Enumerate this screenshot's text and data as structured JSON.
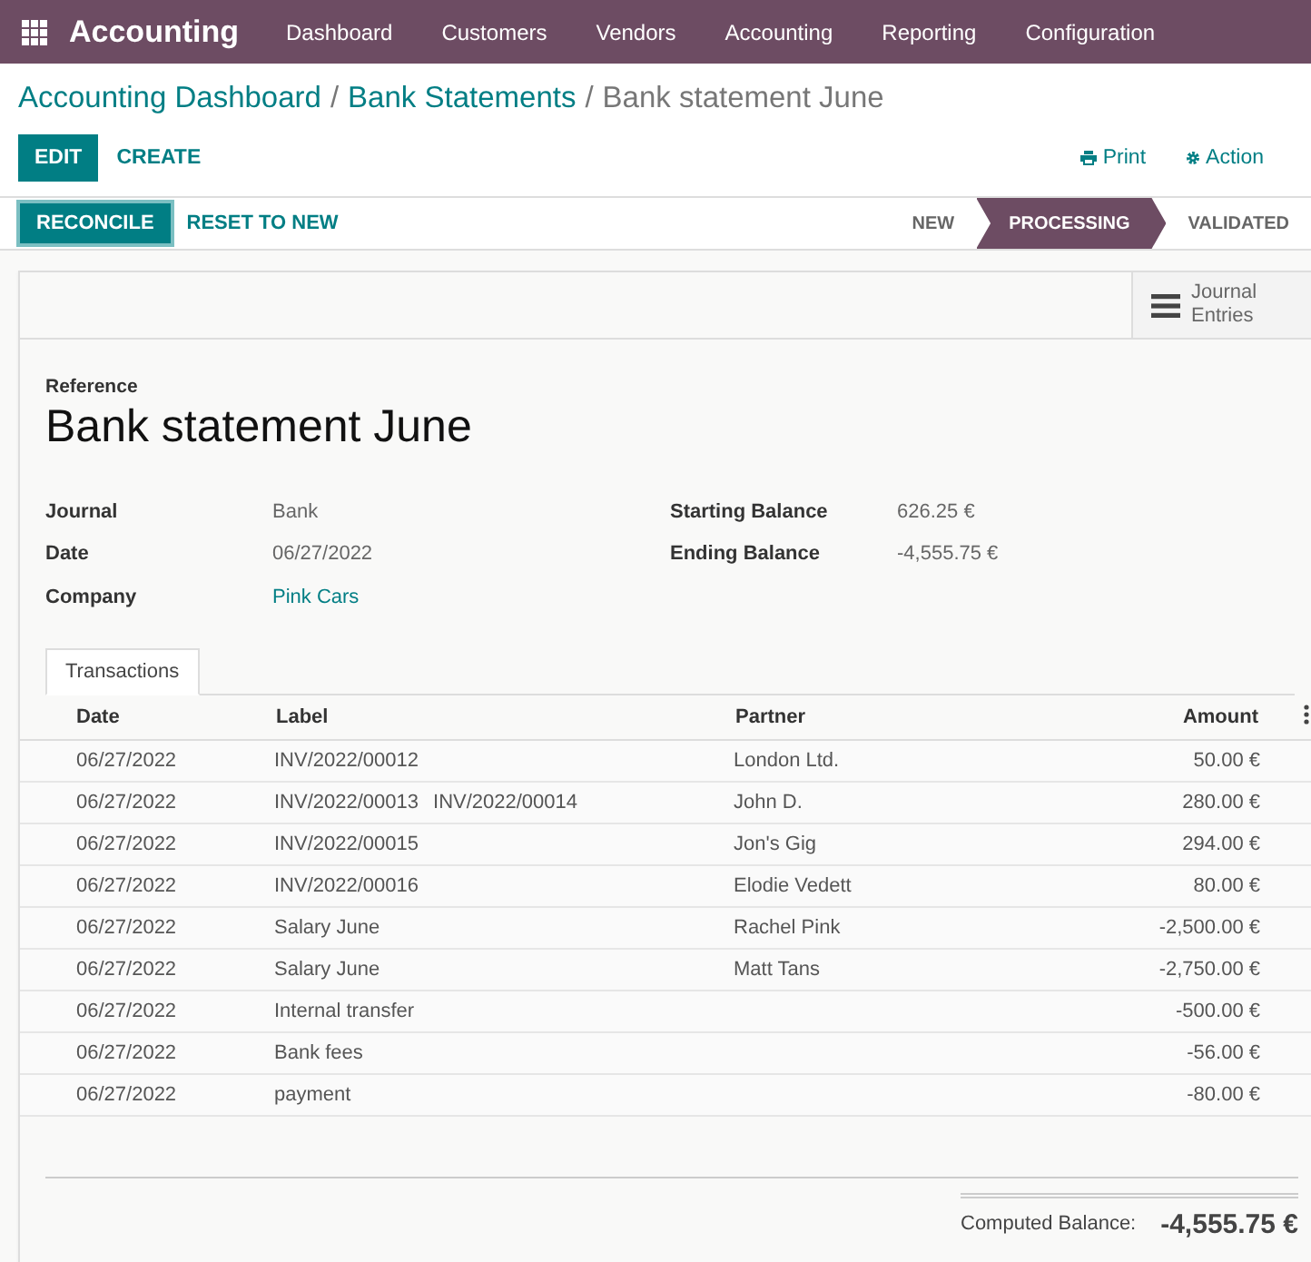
{
  "navbar": {
    "app_name": "Accounting",
    "menu": [
      "Dashboard",
      "Customers",
      "Vendors",
      "Accounting",
      "Reporting",
      "Configuration"
    ]
  },
  "breadcrumb": {
    "links": [
      {
        "label": "Accounting Dashboard",
        "separator": "/"
      },
      {
        "label": "Bank Statements",
        "separator": "/"
      }
    ],
    "current": "Bank statement June"
  },
  "control_buttons": [
    {
      "label": "EDIT",
      "kind": "primary"
    },
    {
      "label": "CREATE",
      "kind": "link"
    }
  ],
  "actions": [
    {
      "label": "Print",
      "kind": "print"
    },
    {
      "label": "Action",
      "kind": "gear"
    }
  ],
  "header_buttons": [
    {
      "label": "RECONCILE",
      "kind": "primary"
    },
    {
      "label": "RESET TO NEW",
      "kind": "link"
    }
  ],
  "status_steps": [
    {
      "label": "NEW",
      "selected": false
    },
    {
      "label": "PROCESSING",
      "selected": true
    },
    {
      "label": "VALIDATED",
      "selected": false
    }
  ],
  "smart_button": {
    "label": "Journal Entries"
  },
  "reference_label": "Reference",
  "title": "Bank statement June",
  "fields_left": [
    {
      "label": "Journal",
      "value": "Bank",
      "kind": "text"
    },
    {
      "label": "Date",
      "value": "06/27/2022",
      "kind": "text"
    },
    {
      "label": "Company",
      "value": "Pink Cars",
      "kind": "link"
    }
  ],
  "fields_right": [
    {
      "label": "Starting Balance",
      "value": "626.25 €"
    },
    {
      "label": "Ending Balance",
      "value": "-4,555.75 €"
    }
  ],
  "tabs": [
    {
      "label": "Transactions",
      "selected": true
    }
  ],
  "table": {
    "columns": [
      "Date",
      "Label",
      "Partner",
      "Amount"
    ],
    "rows": [
      {
        "date": "06/27/2022",
        "labels": [
          "INV/2022/00012"
        ],
        "partner": "London Ltd.",
        "amount": "50.00 €"
      },
      {
        "date": "06/27/2022",
        "labels": [
          "INV/2022/00013",
          "INV/2022/00014"
        ],
        "partner": "John D.",
        "amount": "280.00 €"
      },
      {
        "date": "06/27/2022",
        "labels": [
          "INV/2022/00015"
        ],
        "partner": "Jon's Gig",
        "amount": "294.00 €"
      },
      {
        "date": "06/27/2022",
        "labels": [
          "INV/2022/00016"
        ],
        "partner": "Elodie Vedett",
        "amount": "80.00 €"
      },
      {
        "date": "06/27/2022",
        "labels": [
          "Salary June"
        ],
        "partner": "Rachel Pink",
        "amount": "-2,500.00 €"
      },
      {
        "date": "06/27/2022",
        "labels": [
          "Salary June"
        ],
        "partner": "Matt Tans",
        "amount": "-2,750.00 €"
      },
      {
        "date": "06/27/2022",
        "labels": [
          "Internal transfer"
        ],
        "amount": "-500.00 €"
      },
      {
        "date": "06/27/2022",
        "labels": [
          "Bank fees"
        ],
        "amount": "-56.00 €"
      },
      {
        "date": "06/27/2022",
        "labels": [
          "payment"
        ],
        "amount": "-80.00 €"
      }
    ]
  },
  "computed_balance": {
    "label": "Computed Balance:",
    "value": "-4,555.75 €"
  }
}
